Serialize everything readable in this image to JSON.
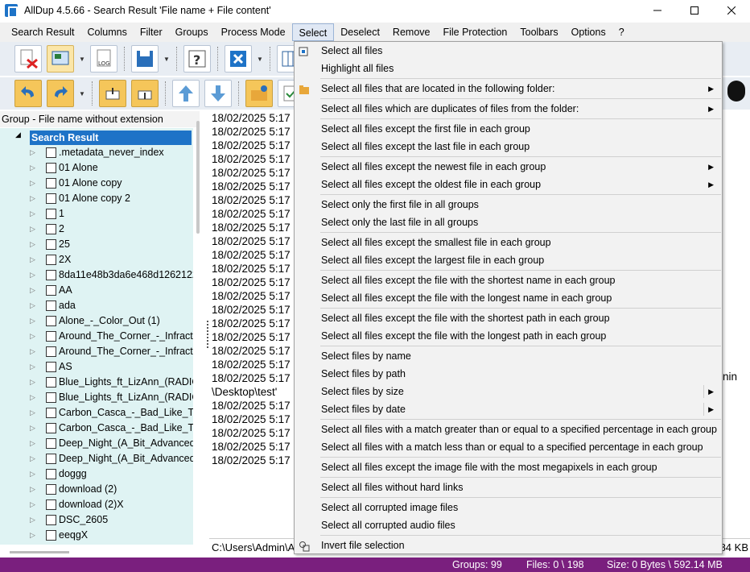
{
  "window": {
    "title": "AllDup 4.5.66 - Search Result 'File name + File content'"
  },
  "menubar": {
    "items": [
      "Search Result",
      "Columns",
      "Filter",
      "Groups",
      "Process Mode",
      "Select",
      "Deselect",
      "Remove",
      "File Protection",
      "Toolbars",
      "Options",
      "?"
    ]
  },
  "tree": {
    "header": "Group - File name without extension",
    "root": "Search Result",
    "items": [
      ".metadata_never_index",
      "01 Alone",
      "01 Alone copy",
      "01 Alone copy 2",
      "1",
      "2",
      "25",
      "2X",
      "8da11e48b3da6e468d126212269",
      "AA",
      "ada",
      "Alone_-_Color_Out (1)",
      "Around_The_Corner_-_Infractio",
      "Around_The_Corner_-_Infractio",
      "AS",
      "Blue_Lights_ft_LizAnn_(RADIO_E",
      "Blue_Lights_ft_LizAnn_(RADIO_E",
      "Carbon_Casca_-_Bad_Like_That",
      "Carbon_Casca_-_Bad_Like_That",
      "Deep_Night_(A_Bit_Advanced_M",
      "Deep_Night_(A_Bit_Advanced_M",
      "doggg",
      "download (2)",
      "download (2)X",
      "DSC_2605",
      "eeqgX"
    ]
  },
  "right": {
    "dates": [
      "18/02/2025 5:17",
      "18/02/2025 5:17",
      "18/02/2025 5:17",
      "18/02/2025 5:17",
      "18/02/2025 5:17",
      "18/02/2025 5:17",
      "18/02/2025 5:17",
      "18/02/2025 5:17",
      "18/02/2025 5:17",
      "18/02/2025 5:17",
      "18/02/2025 5:17",
      "18/02/2025 5:17",
      "18/02/2025 5:17",
      "18/02/2025 5:17",
      "18/02/2025 5:17",
      "18/02/2025 5:17",
      "18/02/2025 5:17",
      "18/02/2025 5:17",
      "18/02/2025 5:17",
      "18/02/2025 5:17",
      "18/02/2025 5:17",
      "18/02/2025 5:17",
      "18/02/2025 5:17",
      "18/02/2025 5:17",
      "18/02/2025 5:17",
      "18/02/2025 5:17"
    ],
    "desktop_text": "\\Desktop\\test'",
    "overflow_text": "nin",
    "path": "C:\\Users\\Admin\\A",
    "size_tail": "84 KB"
  },
  "status": {
    "groups": "Groups: 99",
    "files": "Files: 0 \\ 198",
    "size": "Size: 0 Bytes \\ 592.14 MB"
  },
  "dropdown": {
    "items": [
      {
        "label": "Select all files",
        "submenu": false
      },
      {
        "label": "Highlight all files",
        "submenu": false
      },
      {
        "label": "Select all files that are located in the following folder:",
        "submenu": true
      },
      {
        "label": "Select all files which are duplicates of files from the folder:",
        "submenu": true
      },
      {
        "label": "Select all files except the first file in each group",
        "submenu": false
      },
      {
        "label": "Select all files except the last file in each group",
        "submenu": false
      },
      {
        "label": "Select all files except the newest file in each group",
        "submenu": true
      },
      {
        "label": "Select all files except the oldest file in each group",
        "submenu": true
      },
      {
        "label": "Select only the first file in all groups",
        "submenu": false
      },
      {
        "label": "Select only the last file in all groups",
        "submenu": false
      },
      {
        "label": "Select all files except the smallest file in each group",
        "submenu": false
      },
      {
        "label": "Select all files except the largest file in each group",
        "submenu": false
      },
      {
        "label": "Select all files except the file with the shortest name in each group",
        "submenu": false
      },
      {
        "label": "Select all files except the file with the longest name in each group",
        "submenu": false
      },
      {
        "label": "Select all files except the file with the shortest path in each group",
        "submenu": false
      },
      {
        "label": "Select all files except the file with the longest path in each group",
        "submenu": false
      },
      {
        "label": "Select files by name",
        "submenu": false
      },
      {
        "label": "Select files by path",
        "submenu": false
      },
      {
        "label": "Select files by size",
        "submenu": true
      },
      {
        "label": "Select files by date",
        "submenu": true
      },
      {
        "label": "Select all files with a match greater than or equal to a specified percentage in each group",
        "submenu": false
      },
      {
        "label": "Select all files with a match less than or equal to a specified percentage in each group",
        "submenu": false
      },
      {
        "label": "Select all files except the image file with the most megapixels in each group",
        "submenu": false
      },
      {
        "label": "Select all files without hard links",
        "submenu": false
      },
      {
        "label": "Select all corrupted image files",
        "submenu": false
      },
      {
        "label": "Select all corrupted audio files",
        "submenu": false
      },
      {
        "label": "Invert file selection",
        "submenu": false
      }
    ]
  },
  "colors": {
    "accent": "#1e73c7",
    "statusbar": "#7a1f7e",
    "tree_bg": "#dff3f3"
  }
}
